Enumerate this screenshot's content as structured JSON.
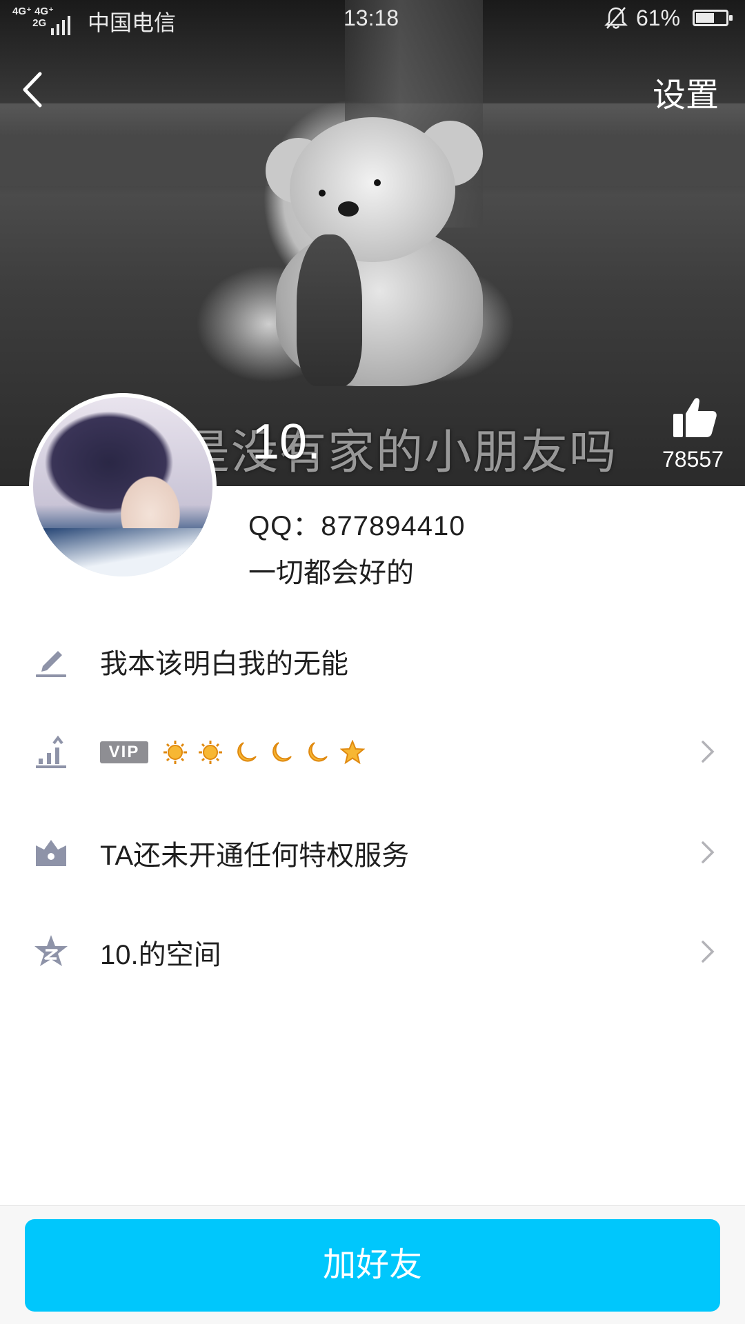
{
  "status_bar": {
    "network": "4G+ 4G+ 2G",
    "carrier": "中国电信",
    "time": "13:18",
    "battery_percent": "61%",
    "battery_level": 0.61
  },
  "nav": {
    "settings_label": "设置"
  },
  "cover": {
    "caption": "是没有家的小朋友吗"
  },
  "profile": {
    "name": "10.",
    "likes": "78557",
    "qq_label": "QQ：",
    "qq_number": "877894410",
    "motto": "一切都会好的"
  },
  "rows": {
    "signature": "我本该明白我的无能",
    "vip_badge": "VIP",
    "vip_levels": [
      "sun",
      "sun",
      "moon",
      "moon",
      "moon",
      "star"
    ],
    "privilege": "TA还未开通任何特权服务",
    "space": "10.的空间"
  },
  "colors": {
    "accent": "#00c7fc",
    "icon_gray": "#8e93a8"
  },
  "bottom": {
    "add_friend_label": "加好友"
  }
}
